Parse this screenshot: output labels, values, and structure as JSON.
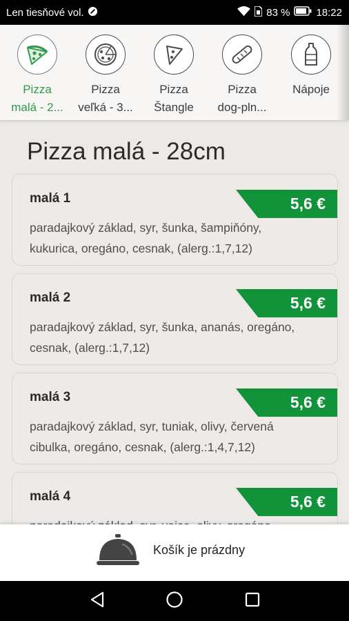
{
  "status_bar": {
    "carrier": "Len tiesňové vol.",
    "battery_percent": "83 %",
    "time": "18:22"
  },
  "categories": [
    {
      "label": "Pizza malá - 2...",
      "line1": "Pizza",
      "line2": "malá - 2...",
      "icon": "pizza-slice-icon",
      "active": true
    },
    {
      "label": "Pizza veľká - 3...",
      "line1": "Pizza",
      "line2": "veľká - 3...",
      "icon": "whole-pizza-icon",
      "active": false
    },
    {
      "label": "Pizza Štangle",
      "line1": "Pizza",
      "line2": "Štangle",
      "icon": "pizza-slice-outline-icon",
      "active": false
    },
    {
      "label": "Pizza dog-pln...",
      "line1": "Pizza",
      "line2": "dog-pln...",
      "icon": "sausage-icon",
      "active": false
    },
    {
      "label": "Nápoje",
      "line1": "Nápoje",
      "line2": "",
      "icon": "bottle-icon",
      "active": false
    }
  ],
  "section": {
    "title": "Pizza malá - 28cm"
  },
  "products": [
    {
      "name": "malá 1",
      "price": "5,6 €",
      "description": "paradajkový základ, syr, šunka, šampiňóny, kukurica, oregáno, cesnak, (alerg.:1,7,12)"
    },
    {
      "name": "malá 2",
      "price": "5,6 €",
      "description": "paradajkový základ, syr, šunka, ananás, oregáno, cesnak, (alerg.:1,7,12)"
    },
    {
      "name": "malá 3",
      "price": "5,6 €",
      "description": "paradajkový základ, syr, tuniak, olivy, červená cibulka, oregáno, cesnak, (alerg.:1,4,7,12)"
    },
    {
      "name": "malá 4",
      "price": "5,6 €",
      "description": "paradajkový základ, syr, vajce, olivy, oregáno, cesnak"
    }
  ],
  "cart": {
    "status": "Košík je prázdny",
    "icon": "cloche-icon"
  },
  "colors": {
    "accent_green": "#2f9a4a",
    "price_green": "#12933a",
    "background": "#ece9e6"
  }
}
